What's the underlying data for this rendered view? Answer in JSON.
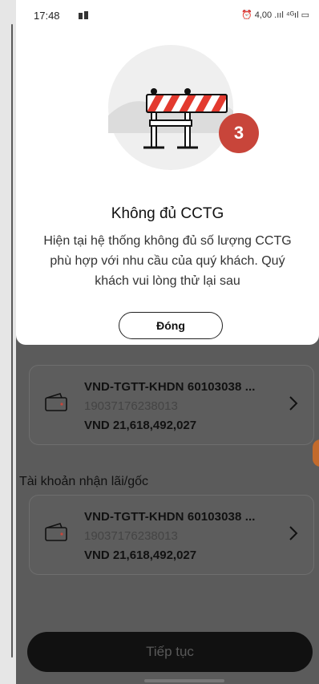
{
  "status_bar": {
    "time": "17:48",
    "right_text": "⏰ 4,00 .ııl ⁴ᴳıl ▭"
  },
  "dialog": {
    "step_badge": "3",
    "title": "Không đủ CCTG",
    "message": "Hiện tại hệ thống không đủ số lượng CCTG phù hợp với nhu cầu của quý khách. Quý khách vui lòng thử lại sau",
    "close_label": "Đóng"
  },
  "source_account": {
    "name": "VND-TGTT-KHDN 60103038 ...",
    "number": "19037176238013",
    "balance": "VND 21,618,492,027"
  },
  "interest_account": {
    "section_label": "Tài khoản nhận lãi/gốc",
    "name": "VND-TGTT-KHDN 60103038 ...",
    "number": "19037176238013",
    "balance": "VND 21,618,492,027"
  },
  "footer": {
    "continue_label": "Tiếp tục"
  },
  "colors": {
    "badge": "#c8453a",
    "barrier_red": "#e33a2f",
    "overlay": "#5b5b5b"
  }
}
